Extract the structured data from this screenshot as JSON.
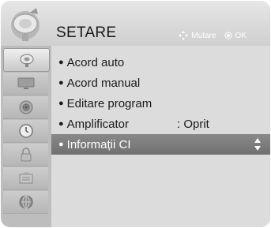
{
  "header": {
    "title": "SETARE",
    "hint_move": "Mutare",
    "hint_ok": "OK",
    "logo_icon": "settings-dish-icon"
  },
  "sidebar": {
    "items": [
      {
        "icon": "settings-dish-icon",
        "active": true
      },
      {
        "icon": "tv-screen-icon",
        "active": false
      },
      {
        "icon": "speaker-icon",
        "active": false
      },
      {
        "icon": "clock-icon",
        "active": false
      },
      {
        "icon": "lock-icon",
        "active": false
      },
      {
        "icon": "options-icon",
        "active": false
      },
      {
        "icon": "network-icon",
        "active": false
      }
    ]
  },
  "menu": {
    "items": [
      {
        "label": "Acord auto",
        "value": ""
      },
      {
        "label": "Acord manual",
        "value": ""
      },
      {
        "label": "Editare program",
        "value": ""
      },
      {
        "label": "Amplificator",
        "value": ": Oprit"
      },
      {
        "label": "Informații CI",
        "value": "",
        "selected": true
      }
    ]
  },
  "colors": {
    "selected_bg": "#7c7c7c",
    "panel_bg": "#dcdcdc",
    "sidebar_bg": "#bdbdbd"
  }
}
